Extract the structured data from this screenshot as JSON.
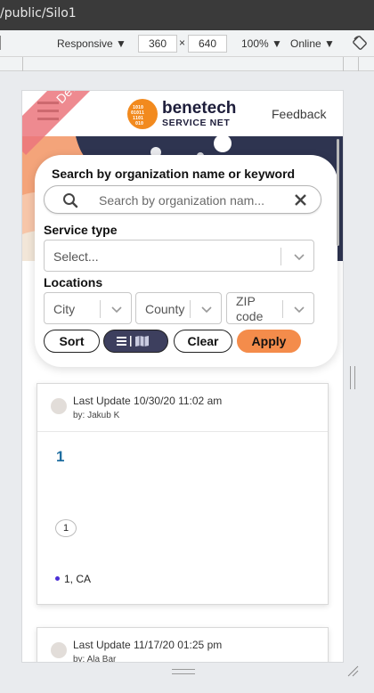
{
  "browser": {
    "url": "/public/Silo1",
    "device_mode": "Responsive ▼",
    "width": "360",
    "times": "×",
    "height": "640",
    "zoom": "100% ▼",
    "network": "Online ▼"
  },
  "header": {
    "logo_title": "benetech",
    "logo_subtitle": "SERVICE NET",
    "feedback_label": "Feedback"
  },
  "ribbon": {
    "label": "Development"
  },
  "search": {
    "title": "Search by organization name or keyword",
    "placeholder": "Search by organization nam...",
    "service_type_label": "Service type",
    "service_type_placeholder": "Select...",
    "locations_label": "Locations",
    "city": "City",
    "county": "County",
    "zip_line1": "ZIP",
    "zip_line2": "code",
    "sort_label": "Sort",
    "clear_label": "Clear",
    "apply_label": "Apply",
    "view_icons": [
      "list-icon",
      "map-icon"
    ]
  },
  "results": [
    {
      "last_update": "Last Update 10/30/20 11:02 am",
      "by": "by: Jakub K",
      "name": "1",
      "count": "1",
      "location": "1, CA"
    },
    {
      "last_update": "Last Update 11/17/20 01:25 pm",
      "by": "by: Ala Bar"
    }
  ],
  "colors": {
    "accent_orange": "#f48c4b",
    "view_button": "#3d3f5e",
    "ribbon": "#eb757d",
    "hero_dark": "#2e3450",
    "hero_peach": "#f4a47a",
    "result_title": "#1f6ea0"
  }
}
